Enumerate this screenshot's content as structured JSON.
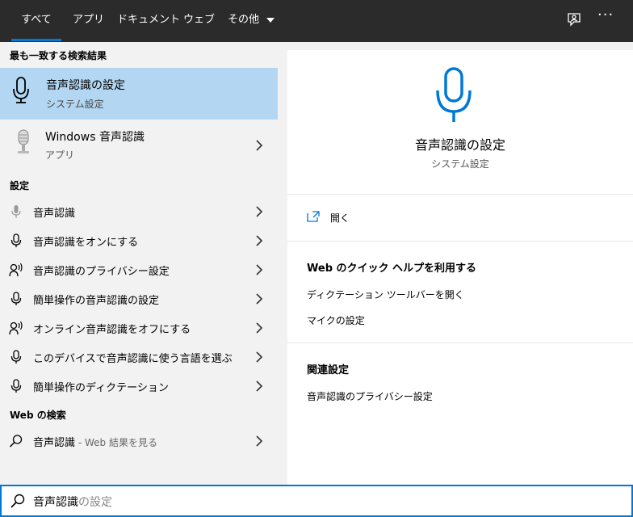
{
  "tabs": [
    "すべて",
    "アプリ",
    "ドキュメント",
    "ウェブ",
    "その他"
  ],
  "accent": "#0078d7",
  "left": {
    "best_match_heading": "最も一致する検索結果",
    "best_match": {
      "title": "音声認識の設定",
      "subtitle": "システム設定",
      "icon": "microphone-icon"
    },
    "app": {
      "title": "Windows 音声認識",
      "subtitle": "アプリ",
      "icon": "studio-microphone-icon"
    },
    "settings_heading": "設定",
    "settings": [
      {
        "label": "音声認識",
        "icon": "microphone-sm-icon"
      },
      {
        "label": "音声認識をオンにする",
        "icon": "microphone-icon"
      },
      {
        "label": "音声認識のプライバシー設定",
        "icon": "person-voice-icon"
      },
      {
        "label": "簡単操作の音声認識の設定",
        "icon": "microphone-icon"
      },
      {
        "label": "オンライン音声認識をオフにする",
        "icon": "person-voice-icon"
      },
      {
        "label": "このデバイスで音声認識に使う言語を選ぶ",
        "icon": "microphone-icon"
      },
      {
        "label": "簡単操作のディクテーション",
        "icon": "microphone-icon"
      }
    ],
    "web_heading": "Web の検索",
    "web": {
      "label": "音声認識",
      "suffix": " - Web 結果を見る"
    }
  },
  "right": {
    "title": "音声認識の設定",
    "subtitle": "システム設定",
    "open_label": "開く",
    "quick_help_heading": "Web のクイック ヘルプを利用する",
    "quick_help_links": [
      "ディクテーション ツールバーを開く",
      "マイクの設定"
    ],
    "related_heading": "関連設定",
    "related_links": [
      "音声認識のプライバシー設定"
    ]
  },
  "search": {
    "typed": "音声認識",
    "suggestion": "の設定"
  }
}
